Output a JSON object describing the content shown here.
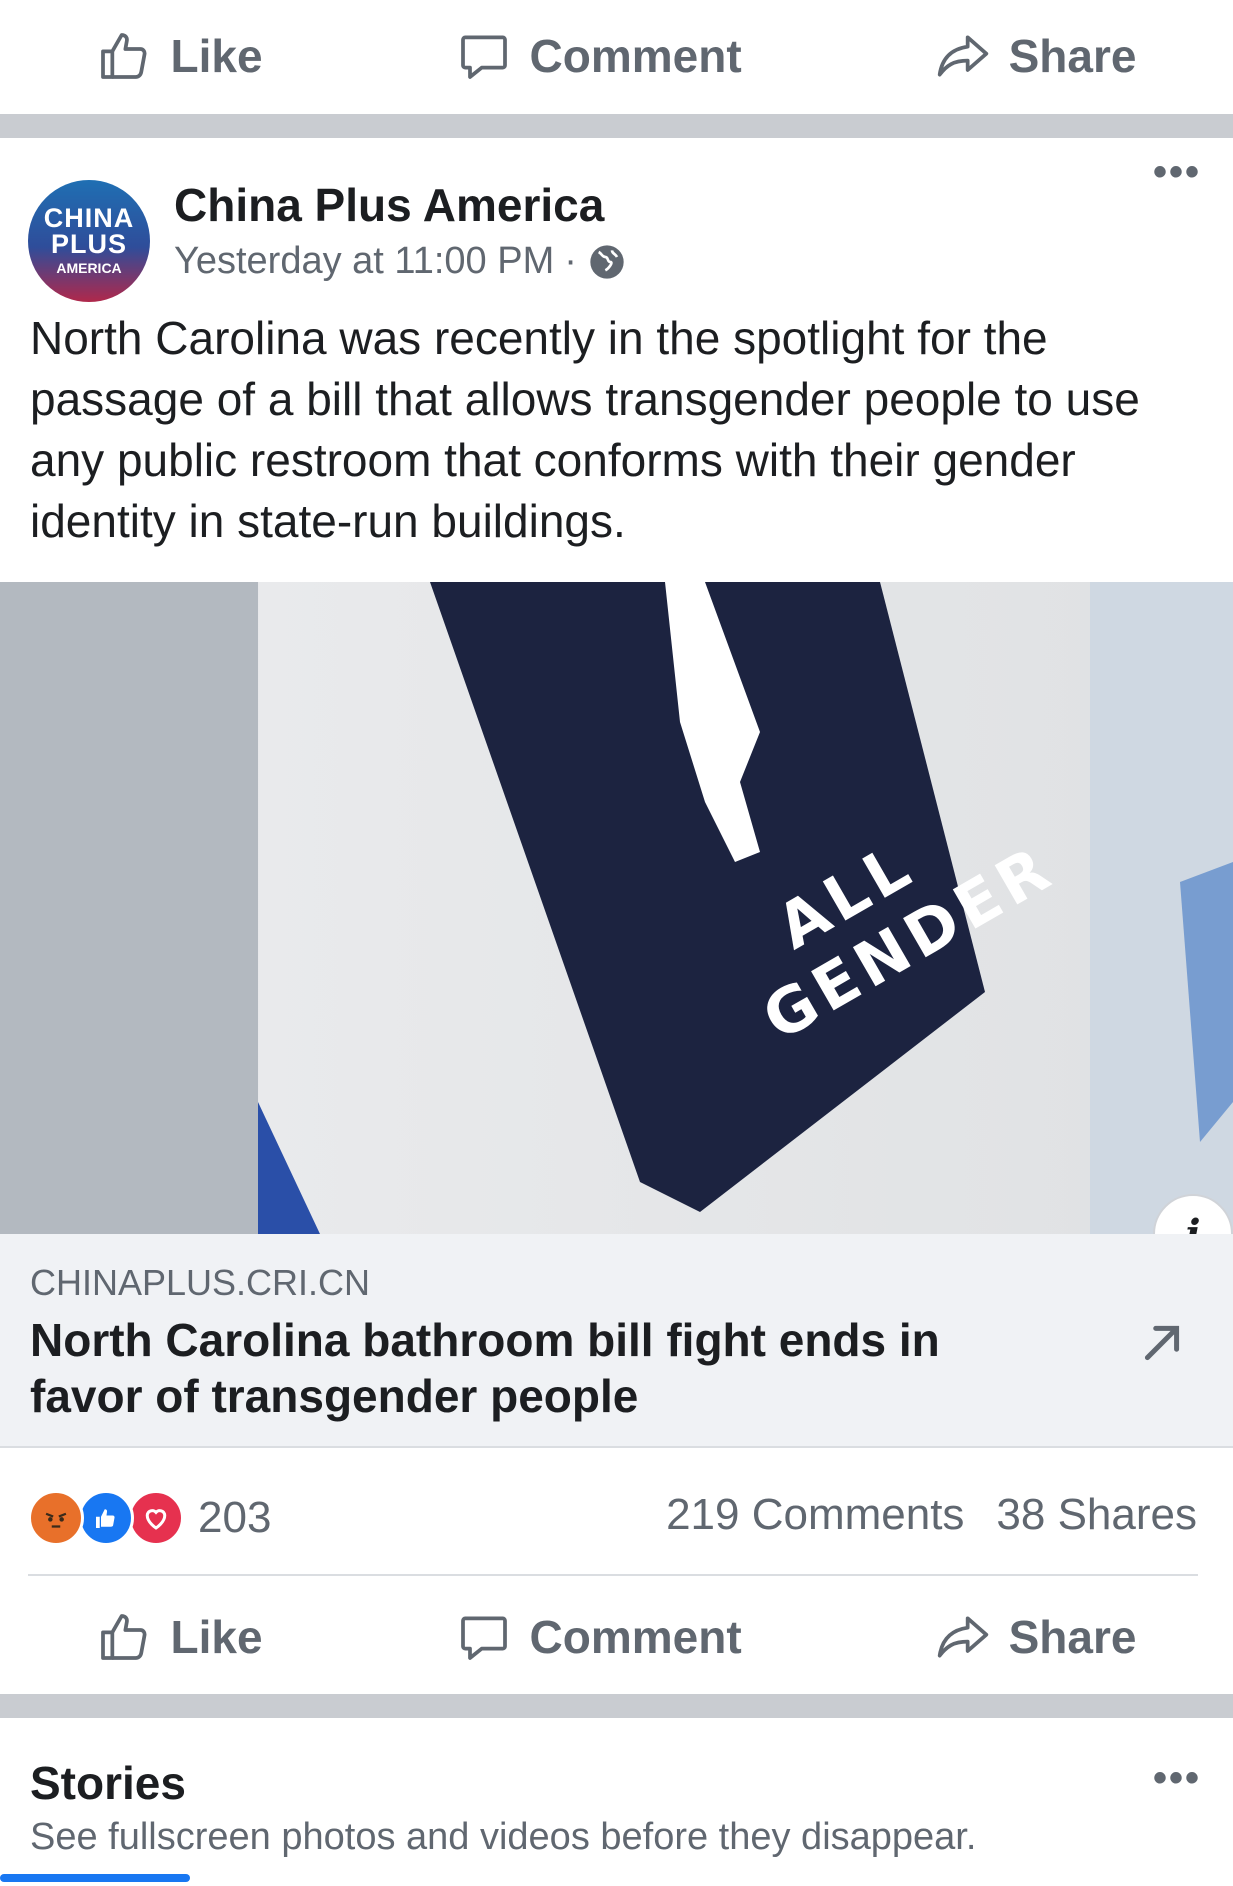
{
  "top_actions": {
    "like": "Like",
    "comment": "Comment",
    "share": "Share"
  },
  "post": {
    "avatar": {
      "line1": "CHINA",
      "line2": "PLUS",
      "line3": "AMERICA"
    },
    "page_name": "China Plus America",
    "time": "Yesterday at 11:00 PM",
    "separator": "·",
    "more": "•••",
    "text": "North Carolina was recently in the spotlight for the passage of a bill that allows transgender people to use any public restroom that conforms with their gender identity in state-run buildings.",
    "image": {
      "sign_line1": "ALL",
      "sign_line2": "GENDER",
      "info": "i"
    },
    "link": {
      "domain": "CHINAPLUS.CRI.CN",
      "title": "North Carolina bathroom bill fight ends in favor of transgender people"
    },
    "reactions": {
      "count": "203",
      "types": [
        "angry",
        "like",
        "love"
      ]
    },
    "comments": "219 Comments",
    "shares": "38 Shares",
    "actions": {
      "like": "Like",
      "comment": "Comment",
      "share": "Share"
    }
  },
  "stories": {
    "title": "Stories",
    "subtitle": "See fullscreen photos and videos before they disappear.",
    "more": "•••"
  },
  "colors": {
    "accent": "#1877f2",
    "secondary_text": "#606770",
    "divider": "#c9ccd1"
  }
}
